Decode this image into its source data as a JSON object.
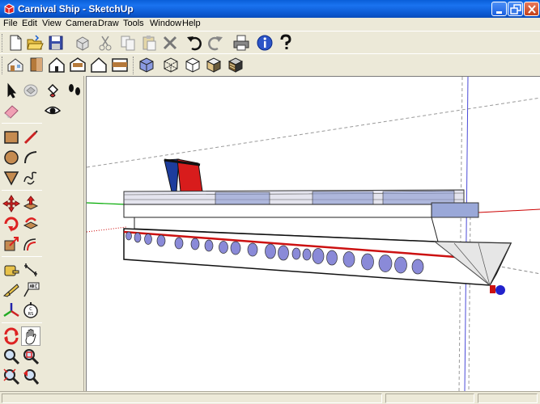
{
  "window": {
    "title": "Carnival Ship - SketchUp",
    "controls": [
      "minimize",
      "maximize",
      "close"
    ]
  },
  "menu": [
    "File",
    "Edit",
    "View",
    "Camera",
    "Draw",
    "Tools",
    "Window",
    "Help"
  ],
  "toolbars": {
    "standard": [
      "new-icon",
      "open-icon",
      "save-icon",
      "make-component-icon",
      "cut-icon",
      "copy-icon",
      "paste-icon",
      "erase-icon",
      "undo-icon",
      "redo-icon",
      "print-icon",
      "model-info-icon",
      "help-icon"
    ],
    "views": [
      "iso-view-icon",
      "top-view-icon",
      "front-view-icon",
      "right-view-icon",
      "back-view-icon",
      "left-view-icon"
    ],
    "face_style": [
      "xray-icon",
      "wireframe-icon",
      "hidden-line-icon",
      "shaded-icon",
      "shaded-textures-icon"
    ],
    "left": [
      "select-icon",
      "component-icon",
      "paint-bucket-icon",
      "walk-icon",
      "eraser-icon",
      "look-around-icon",
      "rectangle-icon",
      "line-icon",
      "circle-icon",
      "arc-icon",
      "polygon-icon",
      "freehand-icon",
      "move-icon",
      "push-pull-icon",
      "rotate-icon",
      "follow-me-icon",
      "scale-icon",
      "offset-icon",
      "tape-measure-icon",
      "dimension-icon",
      "protractor-icon",
      "text-icon",
      "axes-icon",
      "3d-text-icon",
      "orbit-icon",
      "pan-icon",
      "zoom-icon",
      "zoom-window-icon",
      "zoom-extents-icon",
      "previous-icon"
    ]
  },
  "colors": {
    "titlebar": "#0a5fd8",
    "hull_stripe": "#cc1111",
    "funnel_red": "#d81c1c",
    "funnel_blue": "#1c3c9c",
    "porthole": "#8a8ad8",
    "axis_red": "#cc0000",
    "axis_green": "#00aa00",
    "axis_blue": "#0000cc"
  },
  "active_tool": "pan-icon"
}
